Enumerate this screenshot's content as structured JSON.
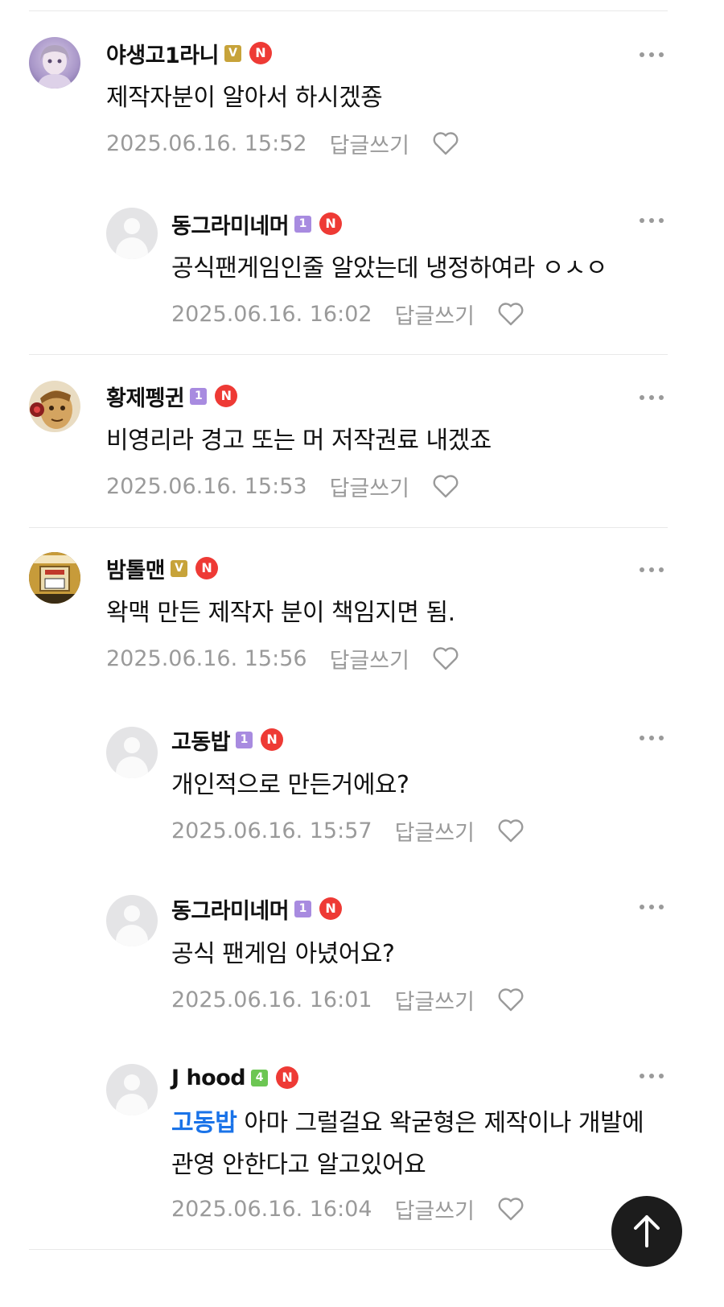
{
  "comments": [
    {
      "nick": "야생고1라니",
      "grade": "V",
      "n_mark": "N",
      "text": "제작자분이 알아서 하시겠죵",
      "time": "2025.06.16. 15:52",
      "reply_label": "답글쓰기"
    },
    {
      "nick": "동그라미네머",
      "grade": "1",
      "n_mark": "N",
      "text": "공식팬게임인줄 알았는데 냉정하여라 ㅇㅅㅇ",
      "time": "2025.06.16. 16:02",
      "reply_label": "답글쓰기"
    },
    {
      "nick": "황제펭귄",
      "grade": "1",
      "n_mark": "N",
      "text": "비영리라 경고 또는 머 저작권료 내겠죠",
      "time": "2025.06.16. 15:53",
      "reply_label": "답글쓰기"
    },
    {
      "nick": "밤톨맨",
      "grade": "V",
      "n_mark": "N",
      "text": "왁맥 만든 제작자 분이 책임지면 됨.",
      "time": "2025.06.16. 15:56",
      "reply_label": "답글쓰기"
    },
    {
      "nick": "고동밥",
      "grade": "1",
      "n_mark": "N",
      "text": "개인적으로 만든거에요?",
      "time": "2025.06.16. 15:57",
      "reply_label": "답글쓰기"
    },
    {
      "nick": "동그라미네머",
      "grade": "1",
      "n_mark": "N",
      "text": "공식 팬게임 아녔어요?",
      "time": "2025.06.16. 16:01",
      "reply_label": "답글쓰기"
    },
    {
      "nick": "J hood",
      "grade": "4",
      "n_mark": "N",
      "mention": "고동밥",
      "text": " 아마 그럴걸요 왁굳형은 제작이나 개발에 관영 안한다고 알고있어요",
      "time": "2025.06.16. 16:04",
      "reply_label": "답글쓰기"
    }
  ],
  "icons": {
    "more": "more-dots-icon",
    "like": "heart-icon",
    "scroll_top": "arrow-up-icon"
  },
  "colors": {
    "mention": "#1a73e8",
    "n_badge": "#ee3a35",
    "grade_v": "#c7a33a",
    "grade_1": "#a88be0",
    "grade_4": "#6cc653"
  }
}
